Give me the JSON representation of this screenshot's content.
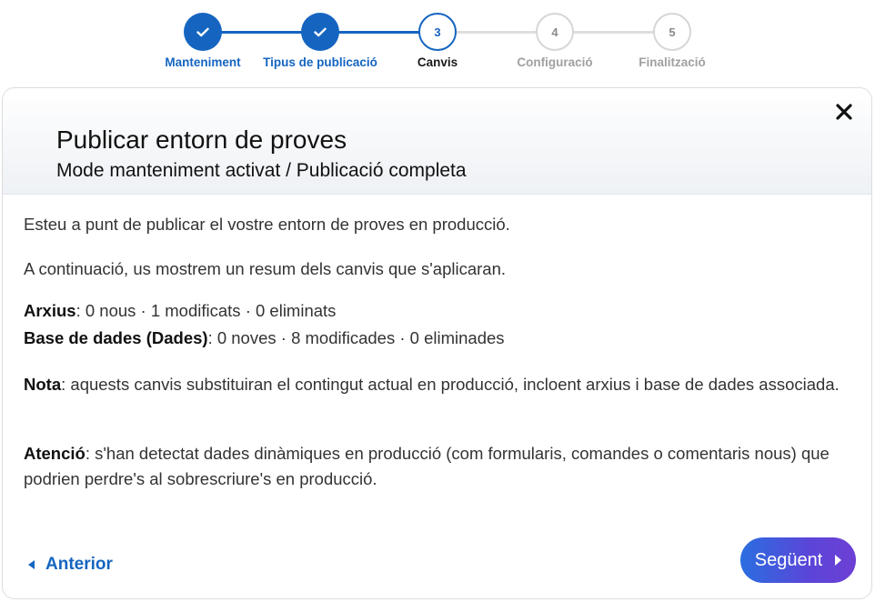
{
  "stepper": {
    "steps": [
      {
        "number": "",
        "label": "Manteniment",
        "state": "done"
      },
      {
        "number": "",
        "label": "Tipus de publicació",
        "state": "done"
      },
      {
        "number": "3",
        "label": "Canvis",
        "state": "current"
      },
      {
        "number": "4",
        "label": "Configuració",
        "state": "todo"
      },
      {
        "number": "5",
        "label": "Finalització",
        "state": "todo"
      }
    ]
  },
  "dialog": {
    "title": "Publicar entorn de proves",
    "subtitle": "Mode manteniment activat / Publicació completa",
    "intro": "Esteu a punt de publicar el vostre entorn de proves en producció.",
    "summary_intro": "A continuació, us mostrem un resum dels canvis que s'aplicaran.",
    "files_label": "Arxius",
    "files_value": ": 0 nous · 1 modificats · 0 eliminats",
    "db_label": "Base de dades (Dades)",
    "db_value": ": 0 noves · 8 modificades · 0 eliminades",
    "note_label": "Nota",
    "note_text": ": aquests canvis substituiran el contingut actual en producció, incloent arxius i base de dades associada.",
    "warning_label": "Atenció",
    "warning_text": ": s'han detectat dades dinàmiques en producció (com formularis, comandes o comentaris nous) que podrien perdre's al sobrescriure's en producció.",
    "prev_label": "Anterior",
    "next_label": "Següent"
  },
  "colors": {
    "accent": "#1565c0",
    "next_gradient_start": "#2a6ee0",
    "next_gradient_end": "#6e3fd4"
  }
}
